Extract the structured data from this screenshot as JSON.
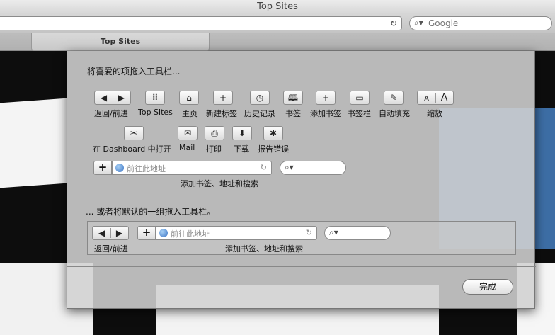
{
  "window": {
    "title": "Top Sites"
  },
  "toolbar": {
    "search_placeholder": "Google",
    "reload_icon": "↻"
  },
  "tabs": [
    {
      "label": "Top Sites"
    }
  ],
  "sheet": {
    "drag_items_heading": "将喜爱的项拖入工具栏...",
    "items": [
      {
        "label": "返回/前进",
        "icon": "◀ ▶"
      },
      {
        "label": "Top Sites",
        "icon": "⠿"
      },
      {
        "label": "主页",
        "icon": "⌂"
      },
      {
        "label": "新建标签",
        "icon": "+"
      },
      {
        "label": "历史记录",
        "icon": "◷"
      },
      {
        "label": "书签",
        "icon": "🕮"
      },
      {
        "label": "添加书签",
        "icon": "+"
      },
      {
        "label": "书签栏",
        "icon": "▭"
      },
      {
        "label": "自动填充",
        "icon": "✎"
      },
      {
        "label": "缩放",
        "icon_small": "A",
        "icon_large": "A"
      },
      {
        "label": "在 Dashboard 中打开",
        "icon": "✂"
      },
      {
        "label": "Mail",
        "icon": "✉"
      },
      {
        "label": "打印",
        "icon": "⎙"
      },
      {
        "label": "下载",
        "icon": "⬇"
      },
      {
        "label": "报告错误",
        "icon": "✱"
      }
    ],
    "address_item": {
      "add_icon": "+",
      "placeholder": "前往此地址",
      "reload_icon": "↻",
      "label": "添加书签、地址和搜索"
    },
    "default_heading": "... 或者将默认的一组拖入工具栏。",
    "default_set": {
      "back_forward_label": "返回/前进",
      "address_placeholder": "前往此地址",
      "address_label": "添加书签、地址和搜索"
    },
    "done_button": "完成"
  }
}
